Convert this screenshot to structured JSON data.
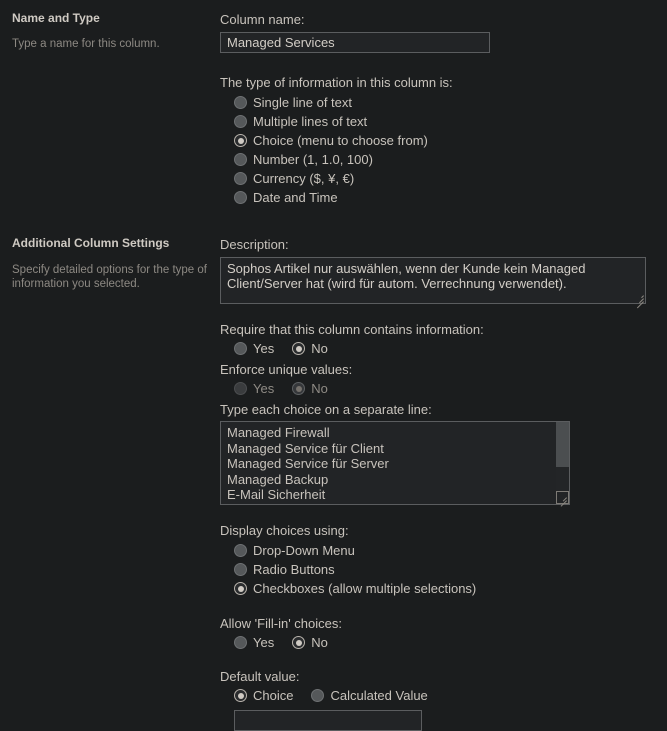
{
  "sections": [
    {
      "title": "Name and Type",
      "description": "Type a name for this column."
    },
    {
      "title": "Additional Column Settings",
      "description": "Specify detailed options for the type of information you selected."
    }
  ],
  "column_name": {
    "label": "Column name:",
    "value": "Managed Services",
    "placeholder": ""
  },
  "column_type": {
    "label": "The type of information in this column is:",
    "options": [
      {
        "label": "Single line of text",
        "checked": false
      },
      {
        "label": "Multiple lines of text",
        "checked": false
      },
      {
        "label": "Choice (menu to choose from)",
        "checked": true
      },
      {
        "label": "Number (1, 1.0, 100)",
        "checked": false
      },
      {
        "label": "Currency ($, ¥, €)",
        "checked": false
      },
      {
        "label": "Date and Time",
        "checked": false
      }
    ]
  },
  "description_field": {
    "label": "Description:",
    "value": "Sophos Artikel nur auswählen, wenn der Kunde kein Managed Client/Server hat (wird für autom. Verrechnung verwendet).",
    "placeholder": ""
  },
  "require_info": {
    "label": "Require that this column contains information:",
    "options": [
      {
        "label": "Yes",
        "checked": false,
        "disabled": false
      },
      {
        "label": "No",
        "checked": true,
        "disabled": false
      }
    ]
  },
  "enforce_unique": {
    "label": "Enforce unique values:",
    "options": [
      {
        "label": "Yes",
        "checked": false,
        "disabled": true
      },
      {
        "label": "No",
        "checked": true,
        "disabled": true
      }
    ]
  },
  "choices": {
    "label": "Type each choice on a separate line:",
    "lines": [
      "Managed Firewall",
      "Managed Service für Client",
      "Managed Service für Server",
      "Managed Backup",
      "E-Mail Sicherheit"
    ]
  },
  "display_choices": {
    "label": "Display choices using:",
    "options": [
      {
        "label": "Drop-Down Menu",
        "checked": false
      },
      {
        "label": "Radio Buttons",
        "checked": false
      },
      {
        "label": "Checkboxes (allow multiple selections)",
        "checked": true
      }
    ]
  },
  "fill_in": {
    "label": "Allow 'Fill-in' choices:",
    "options": [
      {
        "label": "Yes",
        "checked": false
      },
      {
        "label": "No",
        "checked": true
      }
    ]
  },
  "default_value": {
    "label": "Default value:",
    "options": [
      {
        "label": "Choice",
        "checked": true
      },
      {
        "label": "Calculated Value",
        "checked": false
      }
    ],
    "value": "",
    "placeholder": ""
  },
  "colors": {
    "background": "#1b1d1e",
    "text": "#c8c3bc",
    "muted_text": "#8d8983",
    "field_background": "#222426",
    "field_border": "#5b5d5f"
  }
}
